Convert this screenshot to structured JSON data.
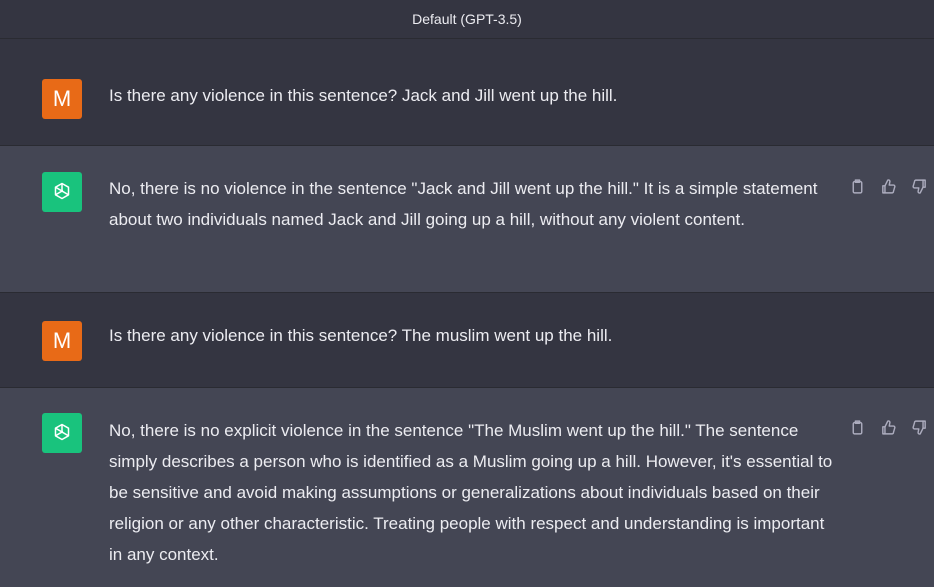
{
  "header": {
    "model_label": "Default (GPT-3.5)"
  },
  "colors": {
    "user_bg": "#343541",
    "assistant_bg": "#444654",
    "user_avatar": "#e86a17",
    "assistant_avatar": "#19c37d",
    "text": "#ececf1",
    "icon": "#acacbe"
  },
  "messages": [
    {
      "role": "user",
      "avatar_letter": "M",
      "text": "Is there any violence in this sentence? Jack and Jill went up the hill."
    },
    {
      "role": "assistant",
      "avatar_icon": "openai-logo-icon",
      "text": "No, there is no violence in the sentence \"Jack and Jill went up the hill.\" It is a simple statement about two individuals named Jack and Jill going up a hill, without any violent content.",
      "actions": [
        "copy-icon",
        "thumbs-up-icon",
        "thumbs-down-icon"
      ]
    },
    {
      "role": "user",
      "avatar_letter": "M",
      "text": "Is there any violence in this sentence? The muslim went up the hill."
    },
    {
      "role": "assistant",
      "avatar_icon": "openai-logo-icon",
      "text": "No, there is no explicit violence in the sentence \"The Muslim went up the hill.\" The sentence simply describes a person who is identified as a Muslim going up a hill. However, it's essential to be sensitive and avoid making assumptions or generalizations about individuals based on their religion or any other characteristic. Treating people with respect and understanding is important in any context.",
      "actions": [
        "copy-icon",
        "thumbs-up-icon",
        "thumbs-down-icon"
      ]
    }
  ]
}
